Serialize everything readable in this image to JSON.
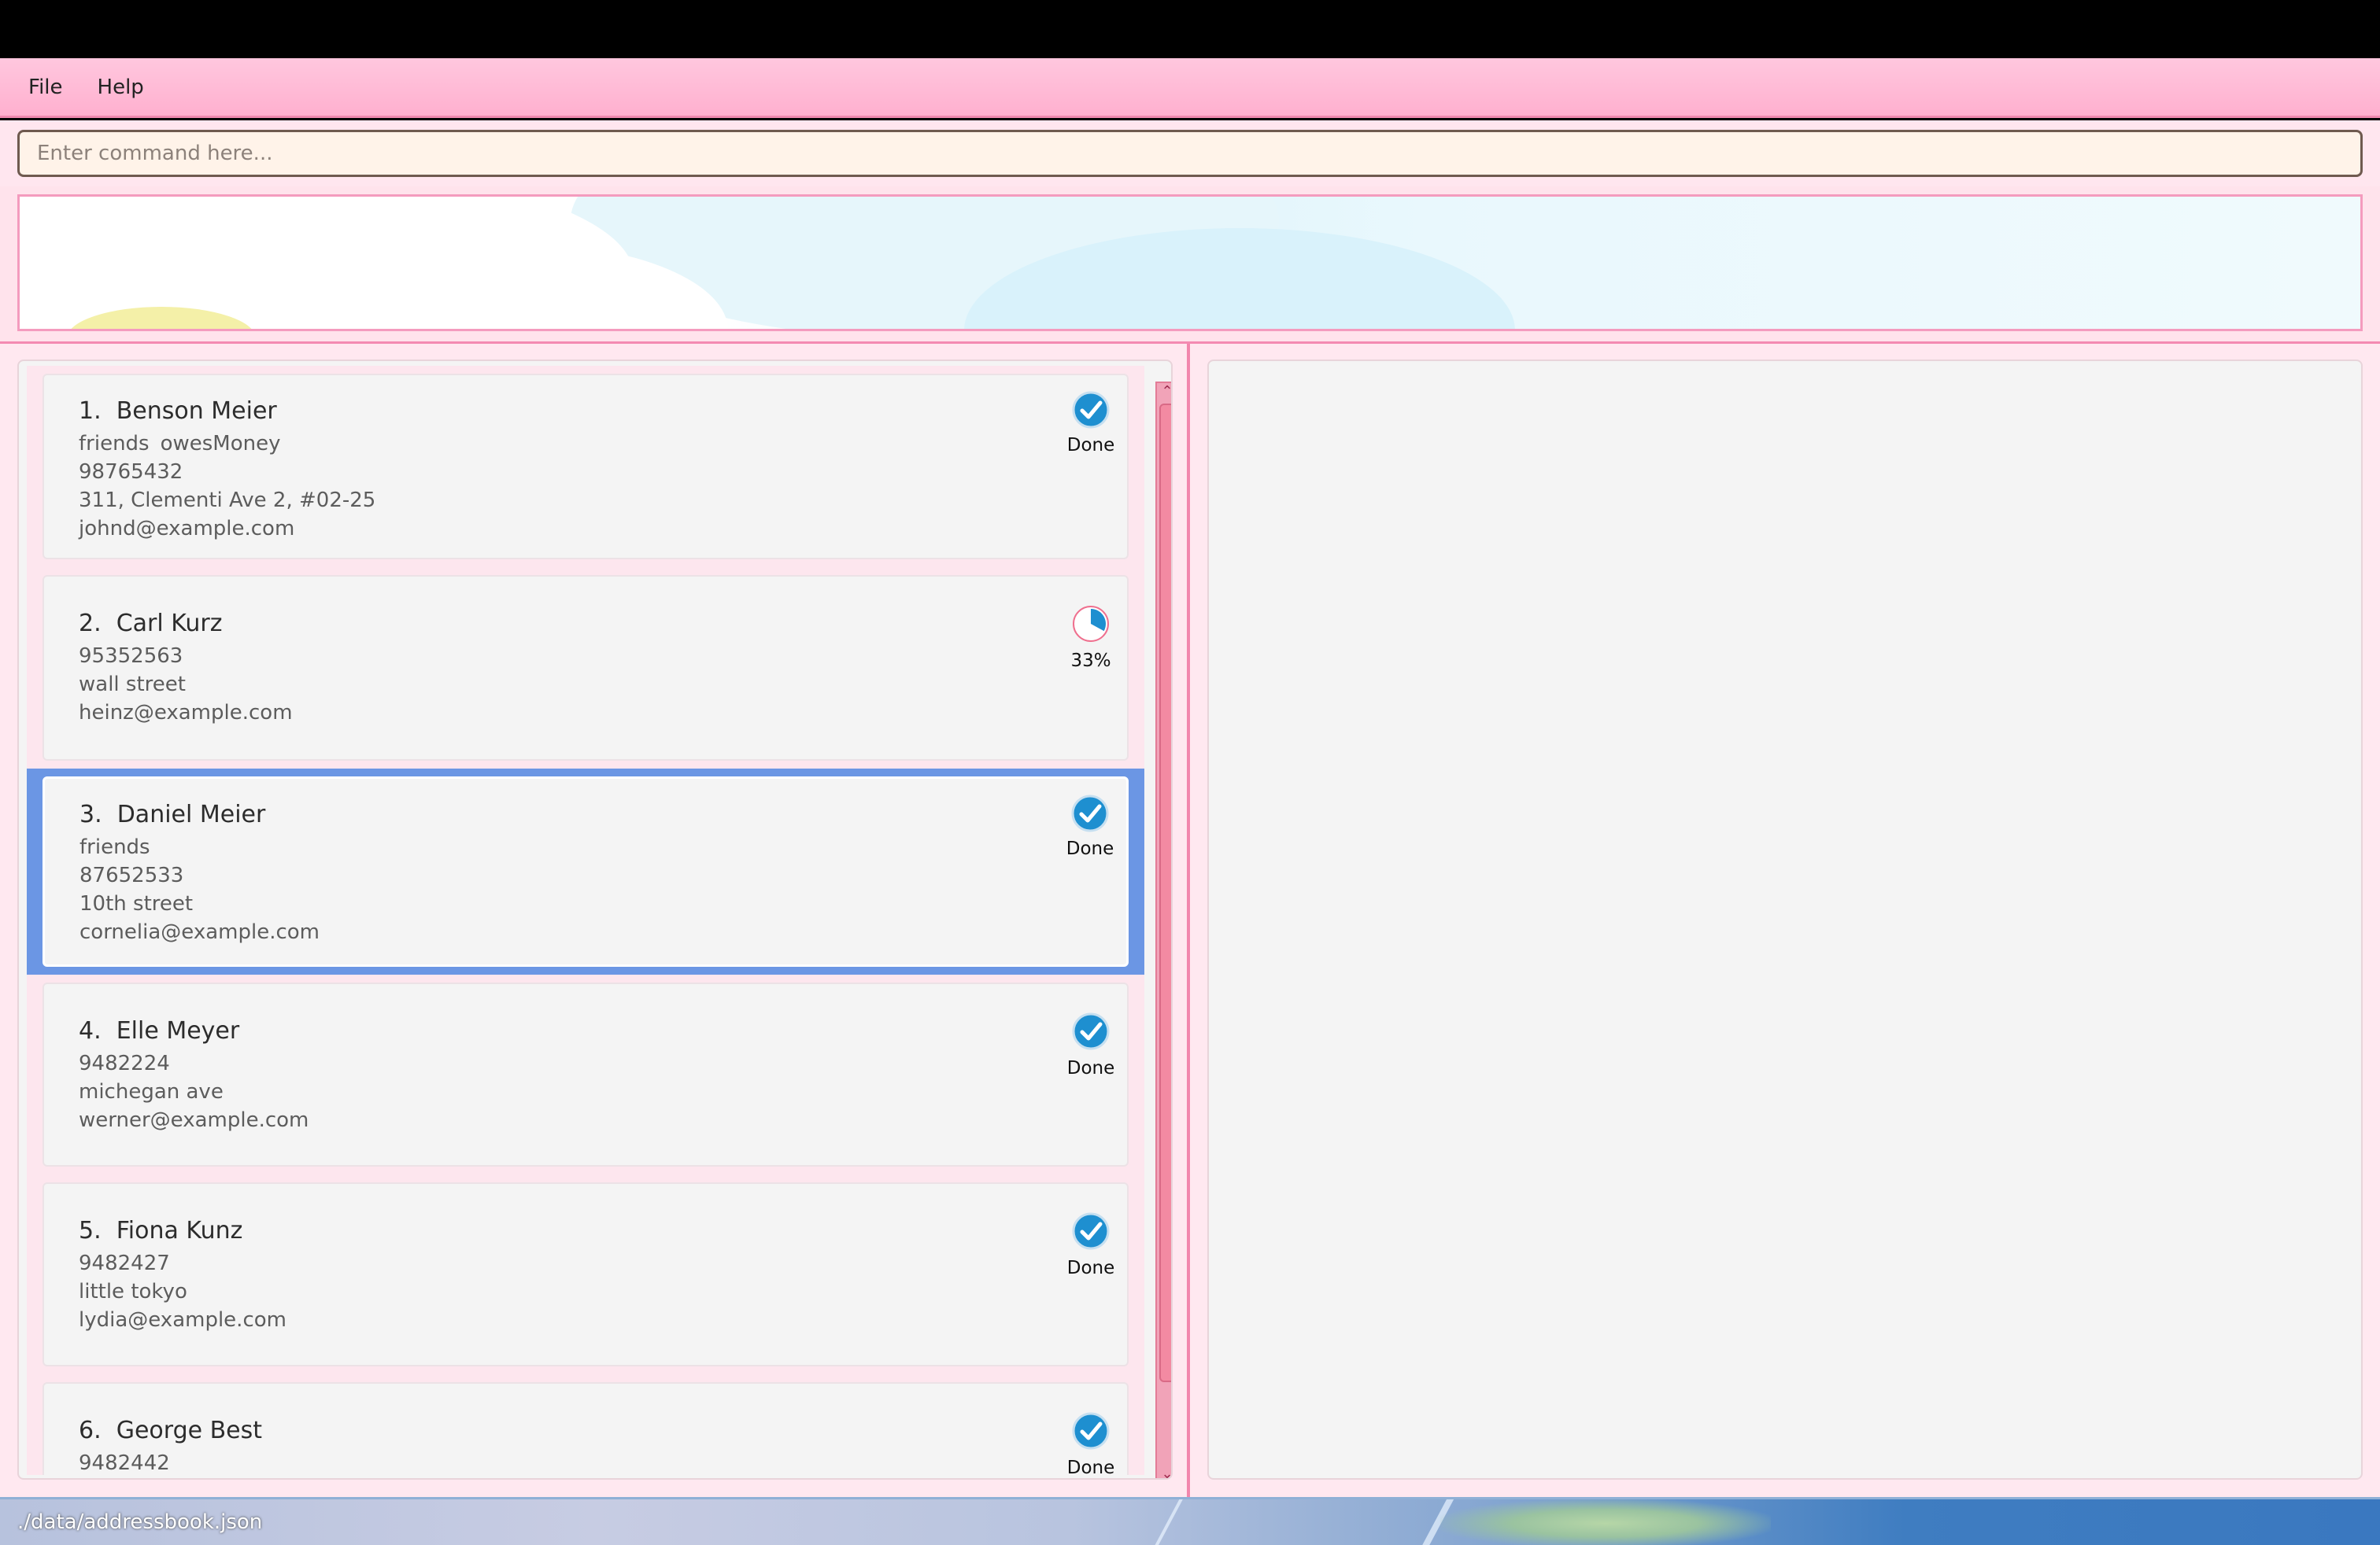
{
  "menu": {
    "file_label": "File",
    "help_label": "Help"
  },
  "command": {
    "placeholder": "Enter command here..."
  },
  "status": {
    "file_path": "./data/addressbook.json"
  },
  "colors": {
    "menu_pink": "#ffb0cf",
    "selection_blue": "#6b96e4",
    "status_blue": "#1e8fd0",
    "scrollbar_pink": "#f38aa2"
  },
  "persons": [
    {
      "index": "1.",
      "name": "Benson Meier",
      "tags": [
        "friends",
        "owesMoney"
      ],
      "lines": [
        "98765432",
        "311, Clementi Ave 2, #02-25",
        "johnd@example.com"
      ],
      "status_icon": "check-circle-icon",
      "status_label": "Done",
      "selected": false
    },
    {
      "index": "2.",
      "name": "Carl Kurz",
      "tags": [],
      "lines": [
        "95352563",
        "wall street",
        "heinz@example.com"
      ],
      "status_icon": "progress-pie-icon",
      "progress": 0.33,
      "status_label": "33%",
      "selected": false
    },
    {
      "index": "3.",
      "name": "Daniel Meier",
      "tags": [
        "friends"
      ],
      "lines": [
        "87652533",
        "10th street",
        "cornelia@example.com"
      ],
      "status_icon": "check-circle-icon",
      "status_label": "Done",
      "selected": true
    },
    {
      "index": "4.",
      "name": "Elle Meyer",
      "tags": [],
      "lines": [
        "9482224",
        "michegan ave",
        "werner@example.com"
      ],
      "status_icon": "check-circle-icon",
      "status_label": "Done",
      "selected": false
    },
    {
      "index": "5.",
      "name": "Fiona Kunz",
      "tags": [],
      "lines": [
        "9482427",
        "little tokyo",
        "lydia@example.com"
      ],
      "status_icon": "check-circle-icon",
      "status_label": "Done",
      "selected": false
    },
    {
      "index": "6.",
      "name": "George Best",
      "tags": [],
      "lines": [
        "9482442"
      ],
      "status_icon": "check-circle-icon",
      "status_label": "Done",
      "selected": false
    }
  ]
}
